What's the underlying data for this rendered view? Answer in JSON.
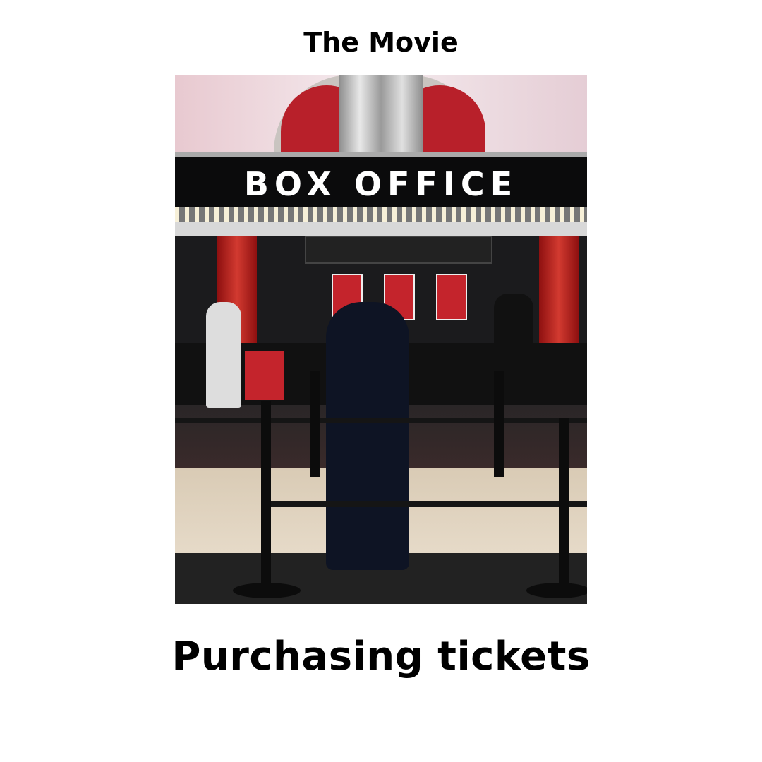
{
  "header": {
    "title": "The Movie"
  },
  "photo": {
    "sign_text": "BOX OFFICE",
    "alt": "photo"
  },
  "footer": {
    "caption": "Purchasing tickets"
  },
  "colors": {
    "text": "#000000",
    "background": "#ffffff",
    "accent_red": "#c4242c"
  }
}
